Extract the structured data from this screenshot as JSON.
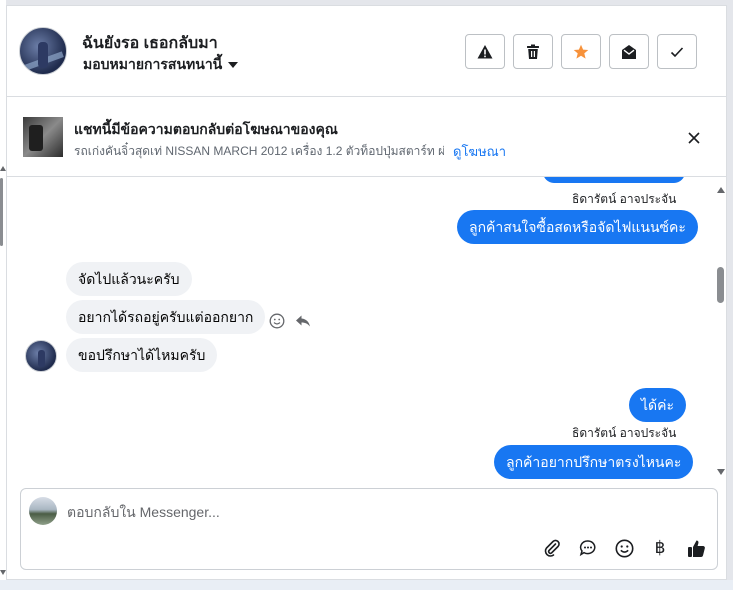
{
  "header": {
    "contact_name": "ฉันยังรอ เธอกลับมา",
    "assign_label": "มอบหมายการสนทนานี้",
    "tools": [
      {
        "icon": "warning-icon",
        "color": "#1c1e21"
      },
      {
        "icon": "trash-icon",
        "color": "#1c1e21"
      },
      {
        "icon": "star-icon",
        "color": "#f7923b"
      },
      {
        "icon": "open-envelope-icon",
        "color": "#1c1e21"
      },
      {
        "icon": "check-icon",
        "color": "#1c1e21"
      }
    ]
  },
  "ad_banner": {
    "title": "แชทนี้มีข้อความตอบกลับต่อโฆษณาของคุณ",
    "description": "รถเก่งคันจิ๋วสุดเท่ NISSAN MARCH 2012 เครื่อง 1.2 ตัวท็อปปุ่มสตาร์ท ผ่...",
    "link": "ดูโฆษณา"
  },
  "messages": {
    "sender_1": "ธิดารัตน์ อาจประจัน",
    "out_1": "ลูกค้าสนใจซื้อสดหรือจัดไฟแนนซ์คะ",
    "in_1": "จัดไปแล้วนะครับ",
    "in_2": "อยากได้รถอยู่ครับแต่ออกยาก",
    "in_3": "ขอปรึกษาได้ไหมครับ",
    "out_2": "ได้ค่ะ",
    "sender_2": "ธิดารัตน์ อาจประจัน",
    "out_3": "ลูกค้าอยากปรึกษาตรงไหนคะ"
  },
  "composer": {
    "placeholder": "ตอบกลับใน Messenger...",
    "icons": [
      "paperclip-icon",
      "chat-bubble-icon",
      "emoji-icon",
      "baht-icon",
      "thumbs-up-icon"
    ],
    "baht_symbol": "฿"
  },
  "colors": {
    "accent": "#1877f2",
    "star": "#f7923b",
    "incoming_bubble": "#f0f2f5"
  }
}
